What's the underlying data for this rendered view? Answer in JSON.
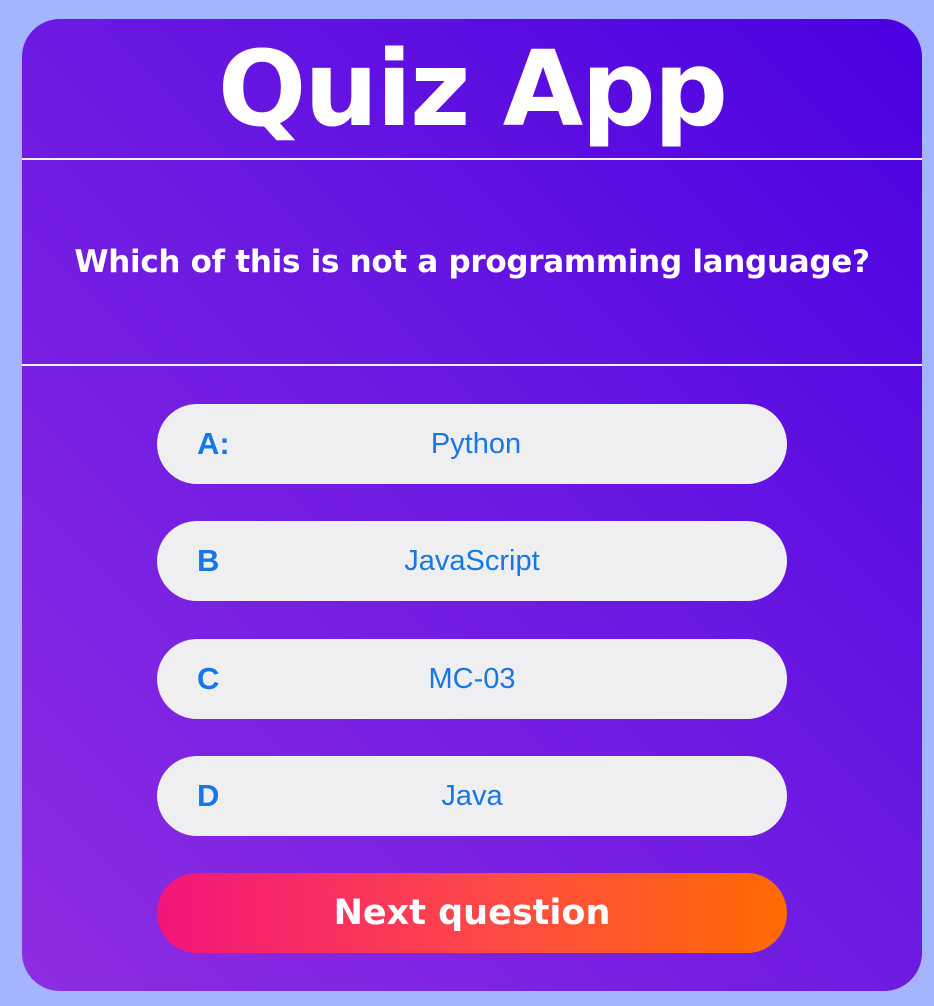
{
  "app": {
    "title": "Quiz App"
  },
  "question": {
    "text": "Which of this is not a programming language?"
  },
  "options": [
    {
      "letter": "A:",
      "label": "Python"
    },
    {
      "letter": "B",
      "label": "JavaScript"
    },
    {
      "letter": "C",
      "label": "MC-03"
    },
    {
      "letter": "D",
      "label": "Java"
    }
  ],
  "actions": {
    "next_label": "Next question"
  },
  "colors": {
    "page_background": "#a4b4ff",
    "card_gradient_start": "#4a00e0",
    "card_gradient_end": "#8e2de2",
    "option_background": "#efeff1",
    "option_text": "#1677e5",
    "next_gradient_start": "#f2157a",
    "next_gradient_end": "#ff6a00"
  }
}
